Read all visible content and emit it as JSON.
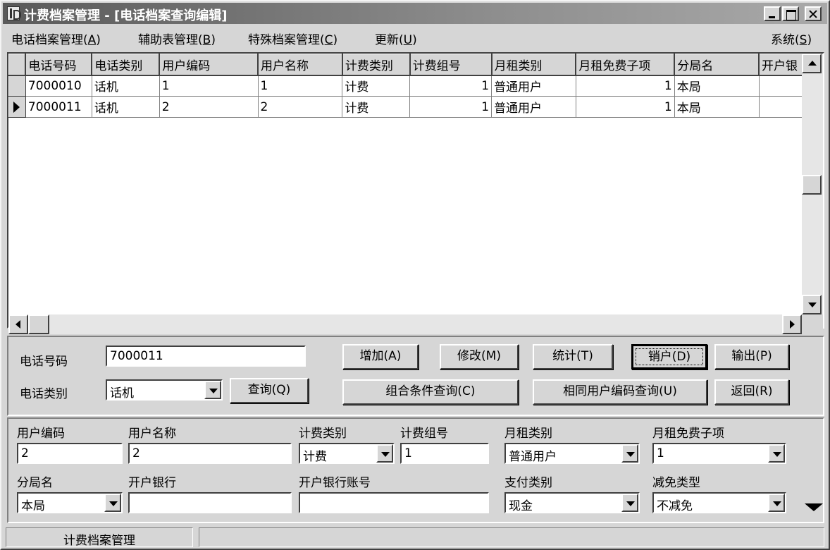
{
  "window": {
    "title": "计费档案管理 - [电话档案查询编辑]"
  },
  "menu": {
    "items": [
      {
        "label": "电话档案管理(",
        "key": "A",
        "suffix": ")"
      },
      {
        "label": "辅助表管理(",
        "key": "B",
        "suffix": ")"
      },
      {
        "label": "特殊档案管理(",
        "key": "C",
        "suffix": ")"
      },
      {
        "label": "更新(",
        "key": "U",
        "suffix": ")"
      },
      {
        "label": "系统(",
        "key": "S",
        "suffix": ")"
      }
    ]
  },
  "grid": {
    "columns": [
      "电话号码",
      "电话类别",
      "用户编码",
      "用户名称",
      "计费类别",
      "计费组号",
      "月租类别",
      "月租免费子项",
      "分局名",
      "开户银"
    ],
    "rows": [
      [
        "7000010",
        "话机",
        "1",
        "1",
        "计费",
        "1",
        "普通用户",
        "1",
        "本局",
        ""
      ],
      [
        "7000011",
        "话机",
        "2",
        "2",
        "计费",
        "1",
        "普通用户",
        "1",
        "本局",
        ""
      ]
    ],
    "current_row": 1
  },
  "search": {
    "phone_label": "电话号码",
    "phone_value": "7000011",
    "type_label": "电话类别",
    "type_value": "话机",
    "query_button": "查询(Q)"
  },
  "buttons": {
    "add": "增加(A)",
    "modify": "修改(M)",
    "stats": "统计(T)",
    "cancel_account": "销户(D)",
    "output": "输出(P)",
    "combo_query": "组合条件查询(C)",
    "same_user_query": "相同用户编码查询(U)",
    "back": "返回(R)"
  },
  "detail": {
    "user_code_label": "用户编码",
    "user_code": "2",
    "user_name_label": "用户名称",
    "user_name": "2",
    "billing_type_label": "计费类别",
    "billing_type": "计费",
    "billing_group_label": "计费组号",
    "billing_group": "1",
    "rent_type_label": "月租类别",
    "rent_type": "普通用户",
    "rent_free_label": "月租免费子项",
    "rent_free": "1",
    "branch_label": "分局名",
    "branch": "本局",
    "bank_label": "开户银行",
    "bank": "",
    "bank_account_label": "开户银行账号",
    "bank_account": "",
    "pay_type_label": "支付类别",
    "pay_type": "现金",
    "discount_label": "减免类型",
    "discount": "不减免"
  },
  "status": {
    "pane1": "计费档案管理",
    "pane2": ""
  },
  "colors": {
    "face": "#d6d6d6",
    "title_dark": "#5a5a5a",
    "grid_bg": "#ffffff"
  }
}
